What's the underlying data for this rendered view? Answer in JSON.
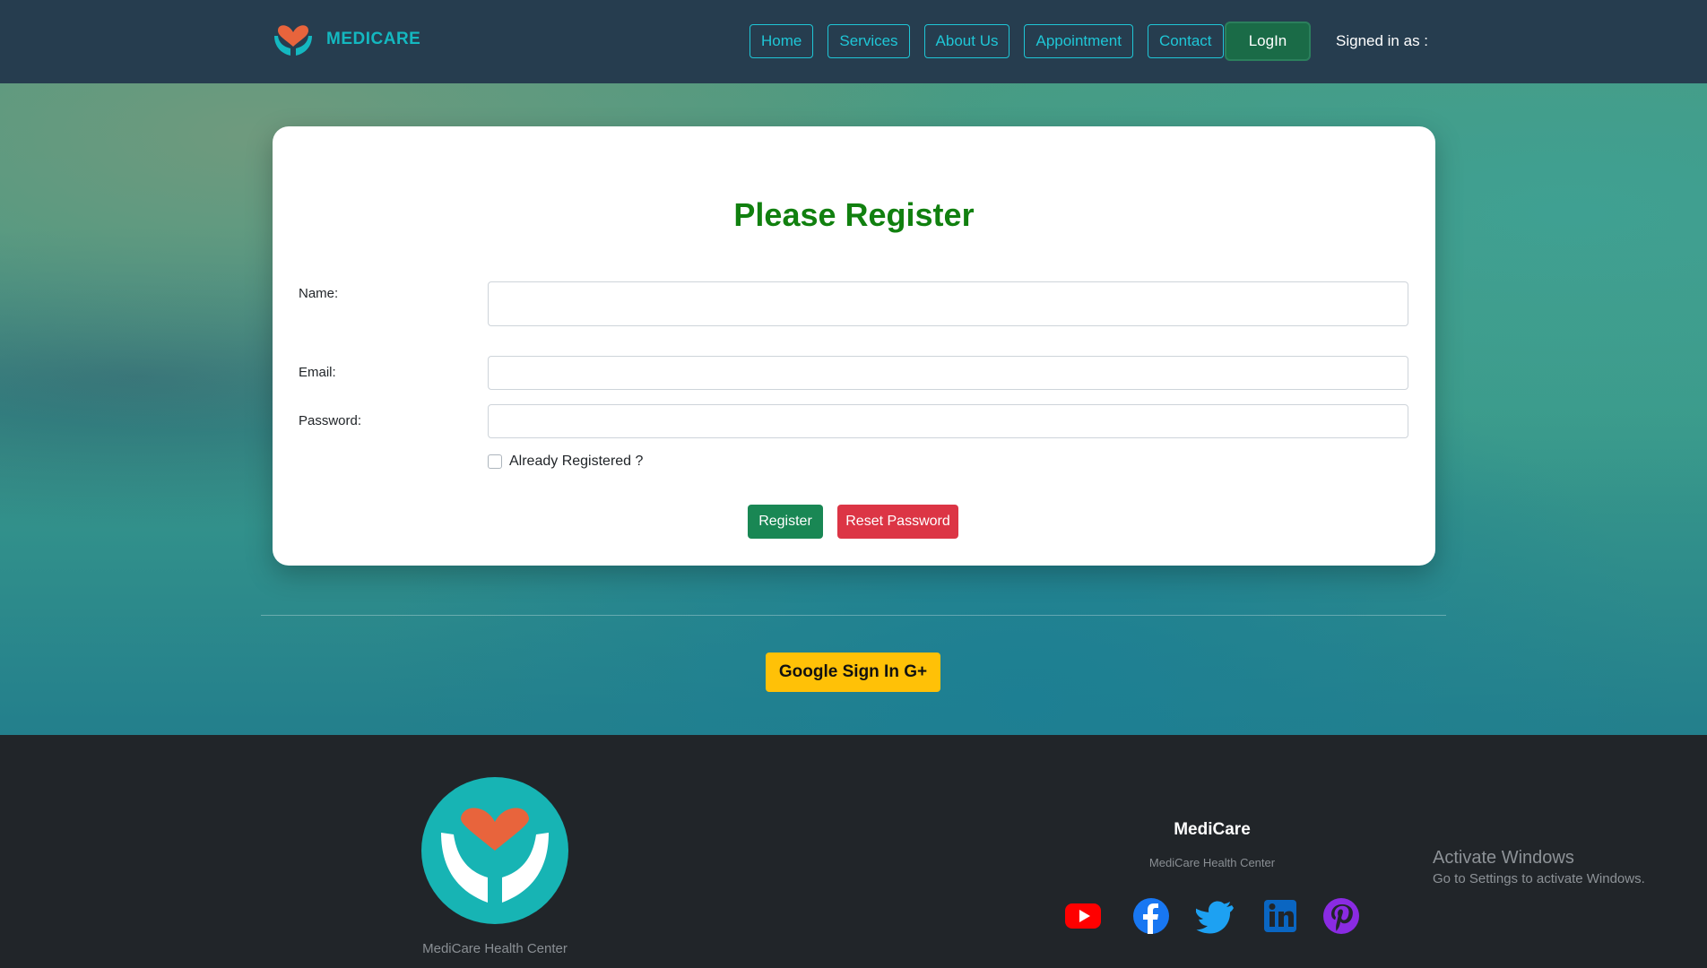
{
  "navbar": {
    "brand": "MEDICARE",
    "links": [
      "Home",
      "Services",
      "About Us",
      "Appointment",
      "Contact"
    ],
    "login_label": "LogIn",
    "signed_in_text": "Signed in as :"
  },
  "register_card": {
    "title": "Please Register",
    "name_label": "Name:",
    "email_label": "Email:",
    "password_label": "Password:",
    "name_value": "",
    "email_value": "",
    "password_value": "",
    "already_registered_label": "Already Registered ?",
    "already_registered_checked": false,
    "register_button": "Register",
    "reset_button": "Reset Password"
  },
  "google_button": "Google Sign In G+",
  "footer": {
    "left_caption": "MediCare Health Center",
    "title": "MediCare",
    "subtitle": "MediCare Health Center",
    "socials": [
      "youtube-icon",
      "facebook-icon",
      "twitter-icon",
      "linkedin-icon",
      "pinterest-icon"
    ]
  },
  "windows_watermark": {
    "title": "Activate Windows",
    "subtitle": "Go to Settings to activate Windows."
  },
  "colors": {
    "navbar": "#263d4f",
    "accent": "#1fc6d6",
    "title_green": "#11800f",
    "register": "#198754",
    "reset": "#dc3545",
    "google": "#ffc107",
    "footer": "#212529"
  }
}
